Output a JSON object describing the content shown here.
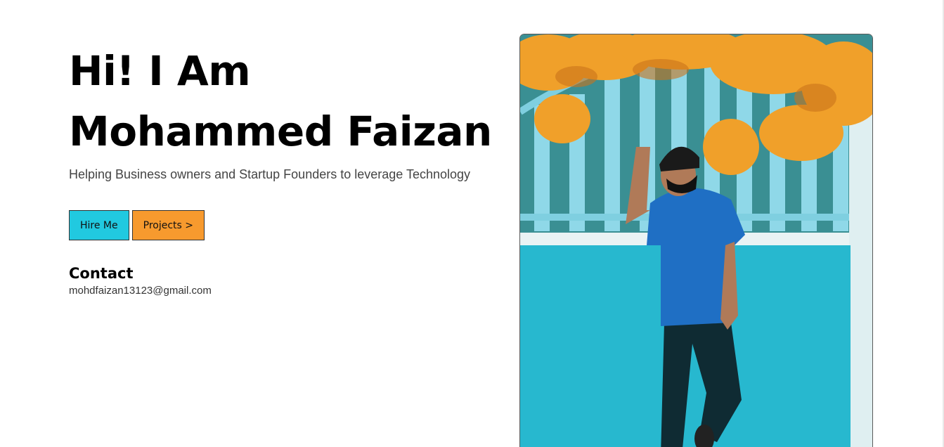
{
  "hero": {
    "title_line1": "Hi! I Am",
    "title_line2": "Mohammed Faizan",
    "tagline": "Helping Business owners and Startup Founders to leverage Technology"
  },
  "buttons": {
    "hire": "Hire Me",
    "projects": "Projects >"
  },
  "contact": {
    "heading": "Contact",
    "email": "mohdfaizan13123@gmail.com"
  },
  "colors": {
    "hire_button": "#21c9e0",
    "projects_button": "#f79a2e",
    "photo_wall": "#2fc2d6",
    "photo_foliage": "#f0a02a",
    "shirt": "#1f6fc4"
  },
  "photo": {
    "icon": "portrait-photo"
  }
}
